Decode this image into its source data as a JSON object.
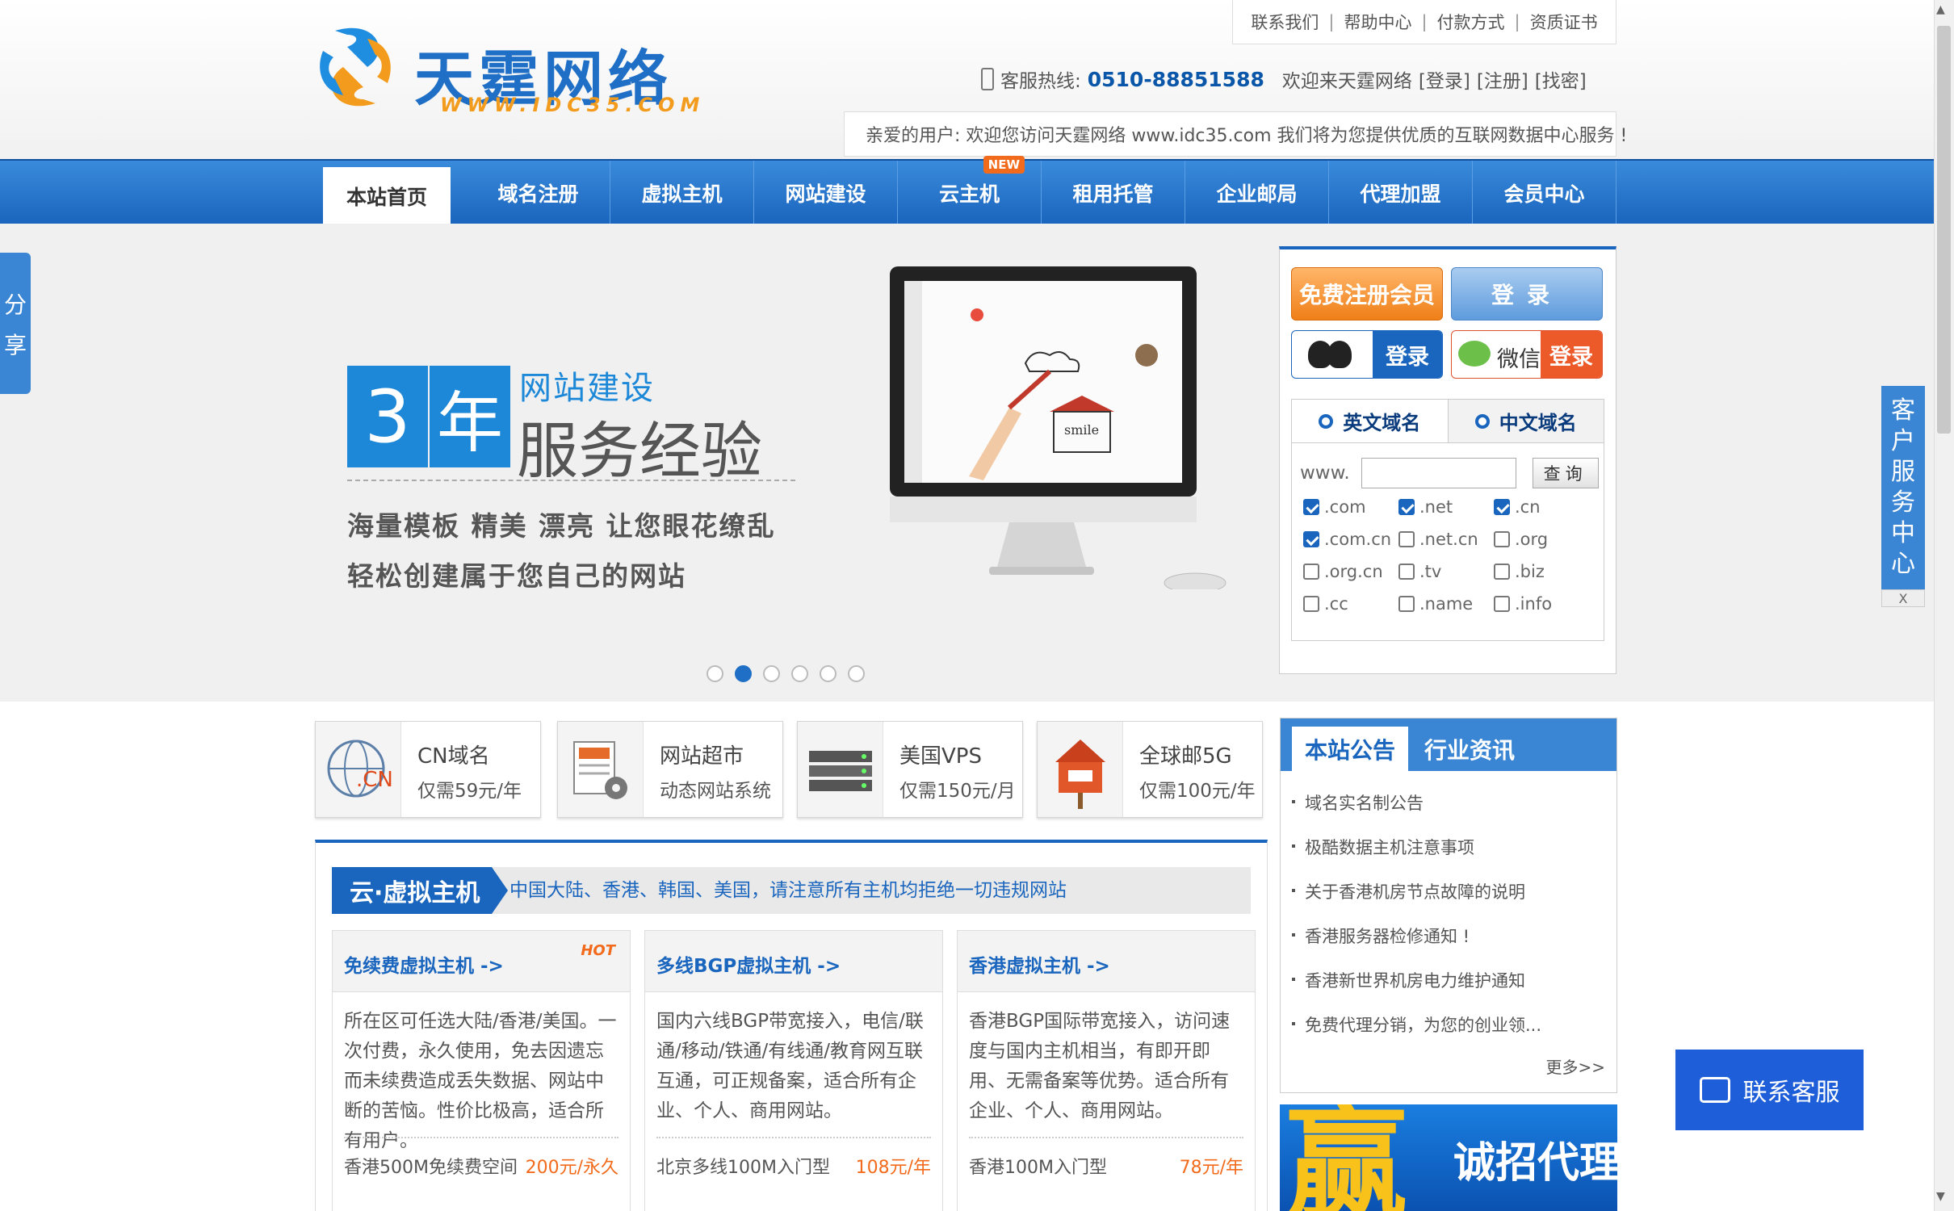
{
  "header": {
    "logo_name": "天霆网络",
    "logo_url": "WWW.IDC35.COM",
    "top_links": [
      "联系我们",
      "帮助中心",
      "付款方式",
      "资质证书"
    ],
    "hotline_label": "客服热线:",
    "hotline_number": "0510-88851588",
    "welcome": "欢迎来天霆网络",
    "auth_links": [
      "[登录]",
      "[注册]",
      "[找密]"
    ],
    "welcome_bar": "亲爱的用户:  欢迎您访问天霆网络 www.idc35.com 我们将为您提供优质的互联网数据中心服务 !"
  },
  "nav": {
    "items": [
      "本站首页",
      "域名注册",
      "虚拟主机",
      "网站建设",
      "云主机",
      "租用托管",
      "企业邮局",
      "代理加盟",
      "会员中心"
    ],
    "new_badge": "NEW"
  },
  "banner": {
    "num": "3",
    "year": "年",
    "sub": "网站建设",
    "main": "服务经验",
    "tag1": "海量模板 精美 漂亮 让您眼花缭乱",
    "tag2": "轻松创建属于您自己的网站",
    "screen_text": "smile",
    "slide_count": 6,
    "active_slide": 2
  },
  "share_tab": [
    "分",
    "享"
  ],
  "login": {
    "register": "免费注册会员",
    "login": "登录",
    "qq_login": "登录",
    "wechat": "微信",
    "wechat_login": "登录"
  },
  "domain": {
    "tab_en": "英文域名",
    "tab_cn": "中文域名",
    "prefix": "www.",
    "input_value": "",
    "query": "查询",
    "tlds": [
      {
        "name": ".com",
        "checked": true
      },
      {
        "name": ".net",
        "checked": true
      },
      {
        "name": ".cn",
        "checked": true
      },
      {
        "name": ".com.cn",
        "checked": true
      },
      {
        "name": ".net.cn",
        "checked": false
      },
      {
        "name": ".org",
        "checked": false
      },
      {
        "name": ".org.cn",
        "checked": false
      },
      {
        "name": ".tv",
        "checked": false
      },
      {
        "name": ".biz",
        "checked": false
      },
      {
        "name": ".cc",
        "checked": false
      },
      {
        "name": ".name",
        "checked": false
      },
      {
        "name": ".info",
        "checked": false
      }
    ]
  },
  "service_tab": [
    "客",
    "户",
    "服",
    "务",
    "中",
    "心"
  ],
  "service_close": "X",
  "products": [
    {
      "title": "CN域名",
      "sub": "仅需59元/年",
      "icon": "globe-cn-icon"
    },
    {
      "title": "网站超市",
      "sub": "动态网站系统",
      "icon": "website-gear-icon"
    },
    {
      "title": "美国VPS",
      "sub": "仅需150元/月",
      "icon": "server-icon"
    },
    {
      "title": "全球邮5G",
      "sub": "仅需100元/年",
      "icon": "mailbox-icon"
    }
  ],
  "hosting": {
    "title": "云·虚拟主机",
    "note": "中国大陆、香港、韩国、美国，请注意所有主机均拒绝一切违规网站",
    "cards": [
      {
        "title": "免续费虚拟主机 ->",
        "hot": "HOT",
        "desc": "所在区可任选大陆/香港/美国。一次付费，永久使用，免去因遗忘而未续费造成丢失数据、网站中断的苦恼。性价比极高，适合所有用户。",
        "plan": "香港500M免续费空间",
        "price": "200元/永久"
      },
      {
        "title": "多线BGP虚拟主机 ->",
        "hot": "",
        "desc": "国内六线BGP带宽接入，电信/联通/移动/铁通/有线通/教育网互联互通，可正规备案，适合所有企业、个人、商用网站。",
        "plan": "北京多线100M入门型",
        "price": "108元/年"
      },
      {
        "title": "香港虚拟主机 ->",
        "hot": "",
        "desc": "香港BGP国际带宽接入，访问速度与国内主机相当，有即开即用、无需备案等优势。适合所有企业、个人、商用网站。",
        "plan": "香港100M入门型",
        "price": "78元/年"
      }
    ]
  },
  "notice": {
    "tab_active": "本站公告",
    "tab_other": "行业资讯",
    "items": [
      "域名实名制公告",
      "极酷数据主机注意事项",
      "关于香港机房节点故障的说明",
      "香港服务器检修通知 !",
      "香港新世界机房电力维护通知",
      "免费代理分销，为您的创业领..."
    ],
    "more": "更多>>"
  },
  "agent_banner": {
    "big": "赢",
    "text": "诚招代理"
  },
  "chat": {
    "label": "联系客服"
  }
}
